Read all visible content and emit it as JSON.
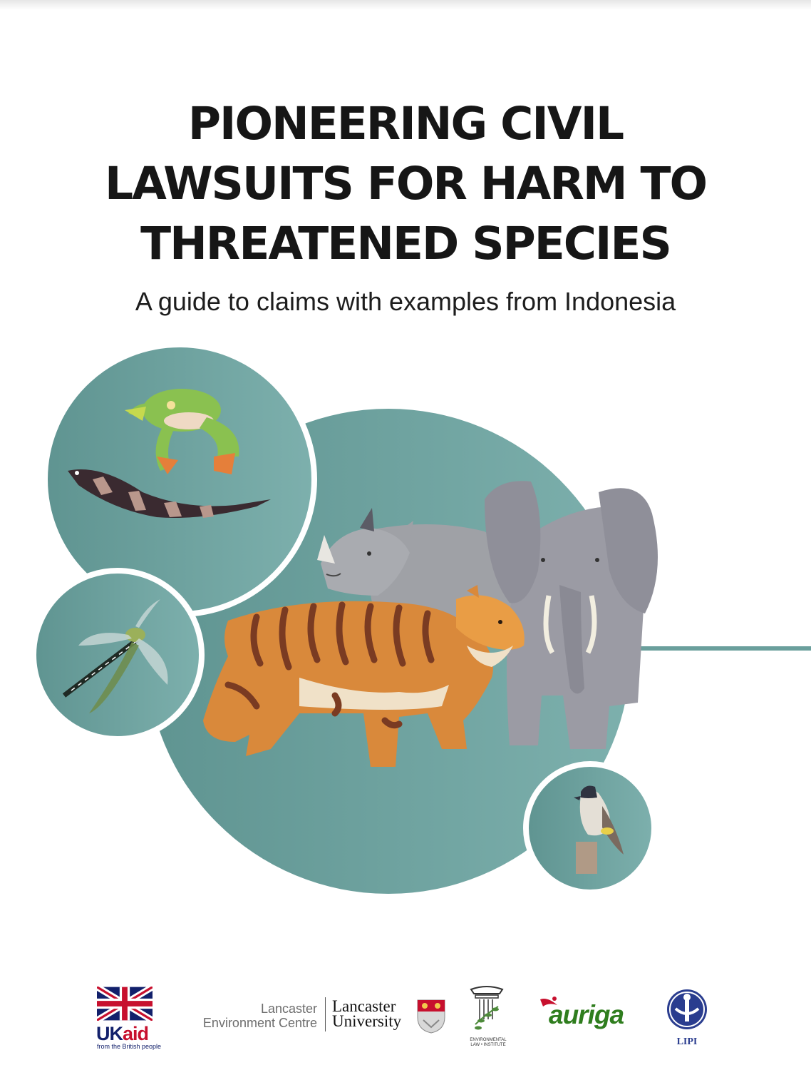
{
  "document": {
    "title_lines": [
      "PIONEERING CIVIL",
      "LAWSUITS FOR HARM TO",
      "THREATENED SPECIES"
    ],
    "subtitle": "A guide to claims with examples from Indonesia"
  },
  "illustration": {
    "animals": [
      "frog",
      "shark",
      "dragonfly",
      "rhinoceros",
      "elephant",
      "tiger",
      "bulbul-bird"
    ],
    "colors": {
      "teal_circle": "#6fa3a0",
      "tiger_orange": "#d9893b",
      "elephant_grey": "#9b9ba4",
      "rhino_grey": "#a9abb0",
      "frog_green": "#8bc34a"
    }
  },
  "logos": {
    "ukaid": {
      "uk": "UK",
      "aid": "aid",
      "tagline": "from the British people"
    },
    "lancaster_env": [
      "Lancaster",
      "Environment Centre"
    ],
    "lancaster_uni": [
      "Lancaster",
      "University"
    ],
    "eli": [
      "ENVIRONMENTAL",
      "LAW • INSTITUTE"
    ],
    "auriga": "auriga",
    "lipi": "LIPI"
  }
}
